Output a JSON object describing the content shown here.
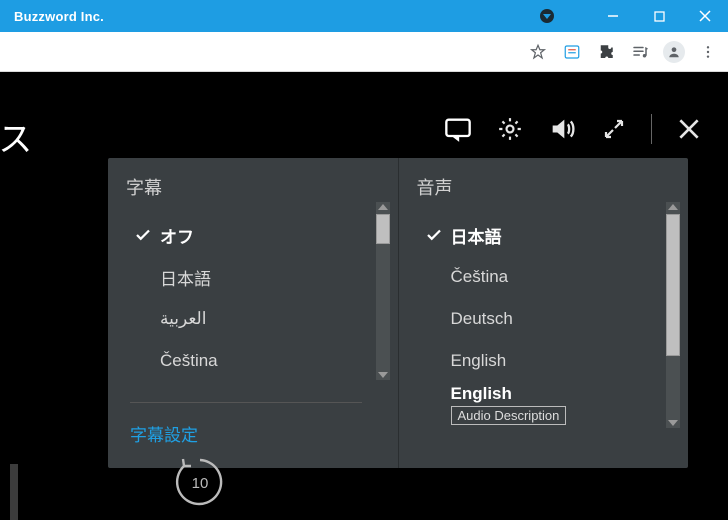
{
  "window": {
    "title": "Buzzword Inc."
  },
  "content": {
    "big_title": "ト・リモース"
  },
  "controls": {
    "subtitle_icon": "subtitle-icon",
    "settings_icon": "gear-icon",
    "volume_icon": "volume-icon",
    "fullscreen_icon": "fullscreen-icon",
    "close_icon": "close-icon"
  },
  "popup": {
    "subtitles": {
      "title": "字幕",
      "options": [
        {
          "label": "オフ",
          "selected": true
        },
        {
          "label": "日本語",
          "selected": false
        },
        {
          "label": "العربية",
          "selected": false
        },
        {
          "label": "Čeština",
          "selected": false
        }
      ],
      "settings_link": "字幕設定"
    },
    "audio": {
      "title": "音声",
      "options": [
        {
          "label": "日本語",
          "selected": true
        },
        {
          "label": "Čeština",
          "selected": false
        },
        {
          "label": "Deutsch",
          "selected": false
        },
        {
          "label": "English",
          "selected": false
        },
        {
          "label": "English",
          "badge": "Audio Description",
          "selected": false
        }
      ]
    }
  },
  "replay": {
    "seconds": "10"
  }
}
